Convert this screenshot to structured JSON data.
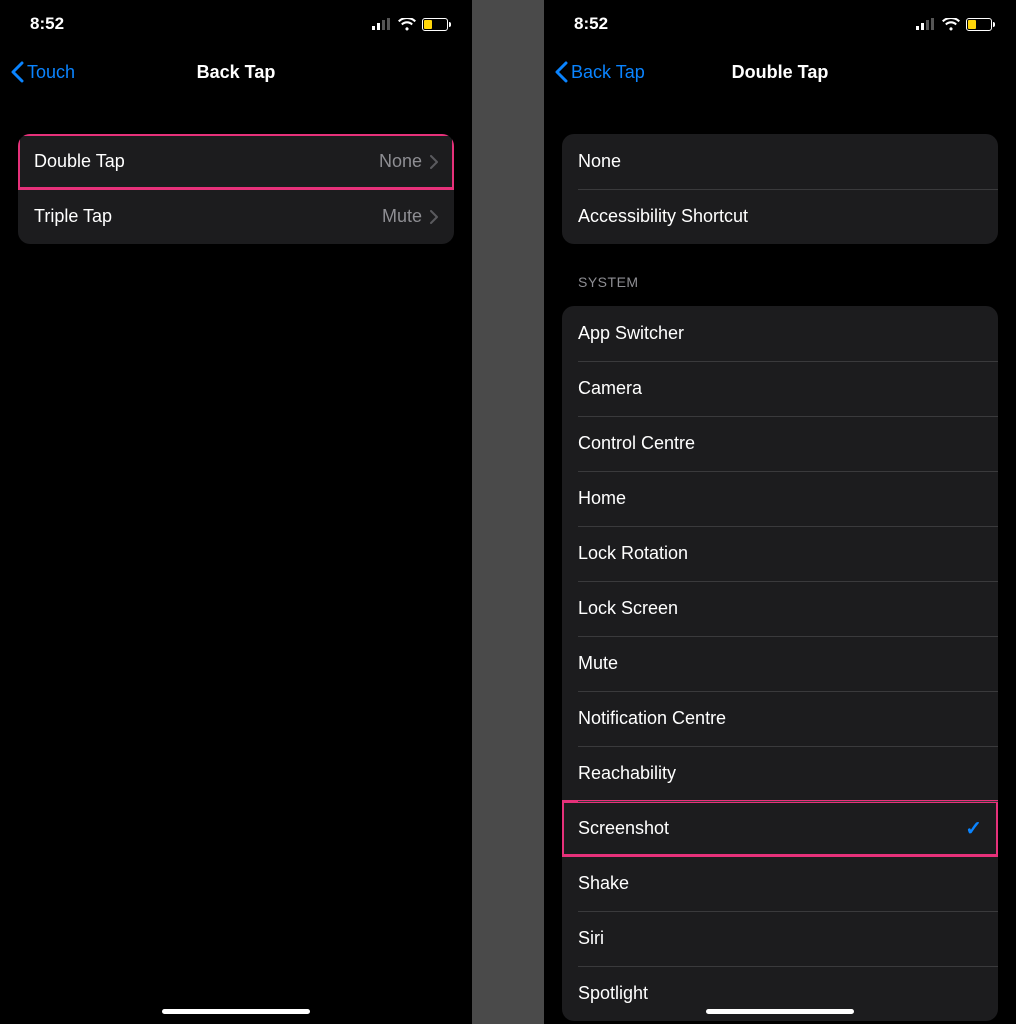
{
  "status": {
    "time": "8:52",
    "battery_pct": 35
  },
  "left": {
    "back_label": "Touch",
    "title": "Back Tap",
    "rows": [
      {
        "label": "Double Tap",
        "value": "None",
        "highlight": true
      },
      {
        "label": "Triple Tap",
        "value": "Mute",
        "highlight": false
      }
    ]
  },
  "right": {
    "back_label": "Back Tap",
    "title": "Double Tap",
    "top_rows": [
      {
        "label": "None"
      },
      {
        "label": "Accessibility Shortcut"
      }
    ],
    "section_header": "SYSTEM",
    "system_rows": [
      {
        "label": "App Switcher",
        "checked": false
      },
      {
        "label": "Camera",
        "checked": false
      },
      {
        "label": "Control Centre",
        "checked": false
      },
      {
        "label": "Home",
        "checked": false
      },
      {
        "label": "Lock Rotation",
        "checked": false
      },
      {
        "label": "Lock Screen",
        "checked": false
      },
      {
        "label": "Mute",
        "checked": false
      },
      {
        "label": "Notification Centre",
        "checked": false
      },
      {
        "label": "Reachability",
        "checked": false
      },
      {
        "label": "Screenshot",
        "checked": true,
        "highlight": true
      },
      {
        "label": "Shake",
        "checked": false
      },
      {
        "label": "Siri",
        "checked": false
      },
      {
        "label": "Spotlight",
        "checked": false
      }
    ]
  },
  "colors": {
    "accent": "#0a84ff",
    "highlight": "#e6317a"
  }
}
